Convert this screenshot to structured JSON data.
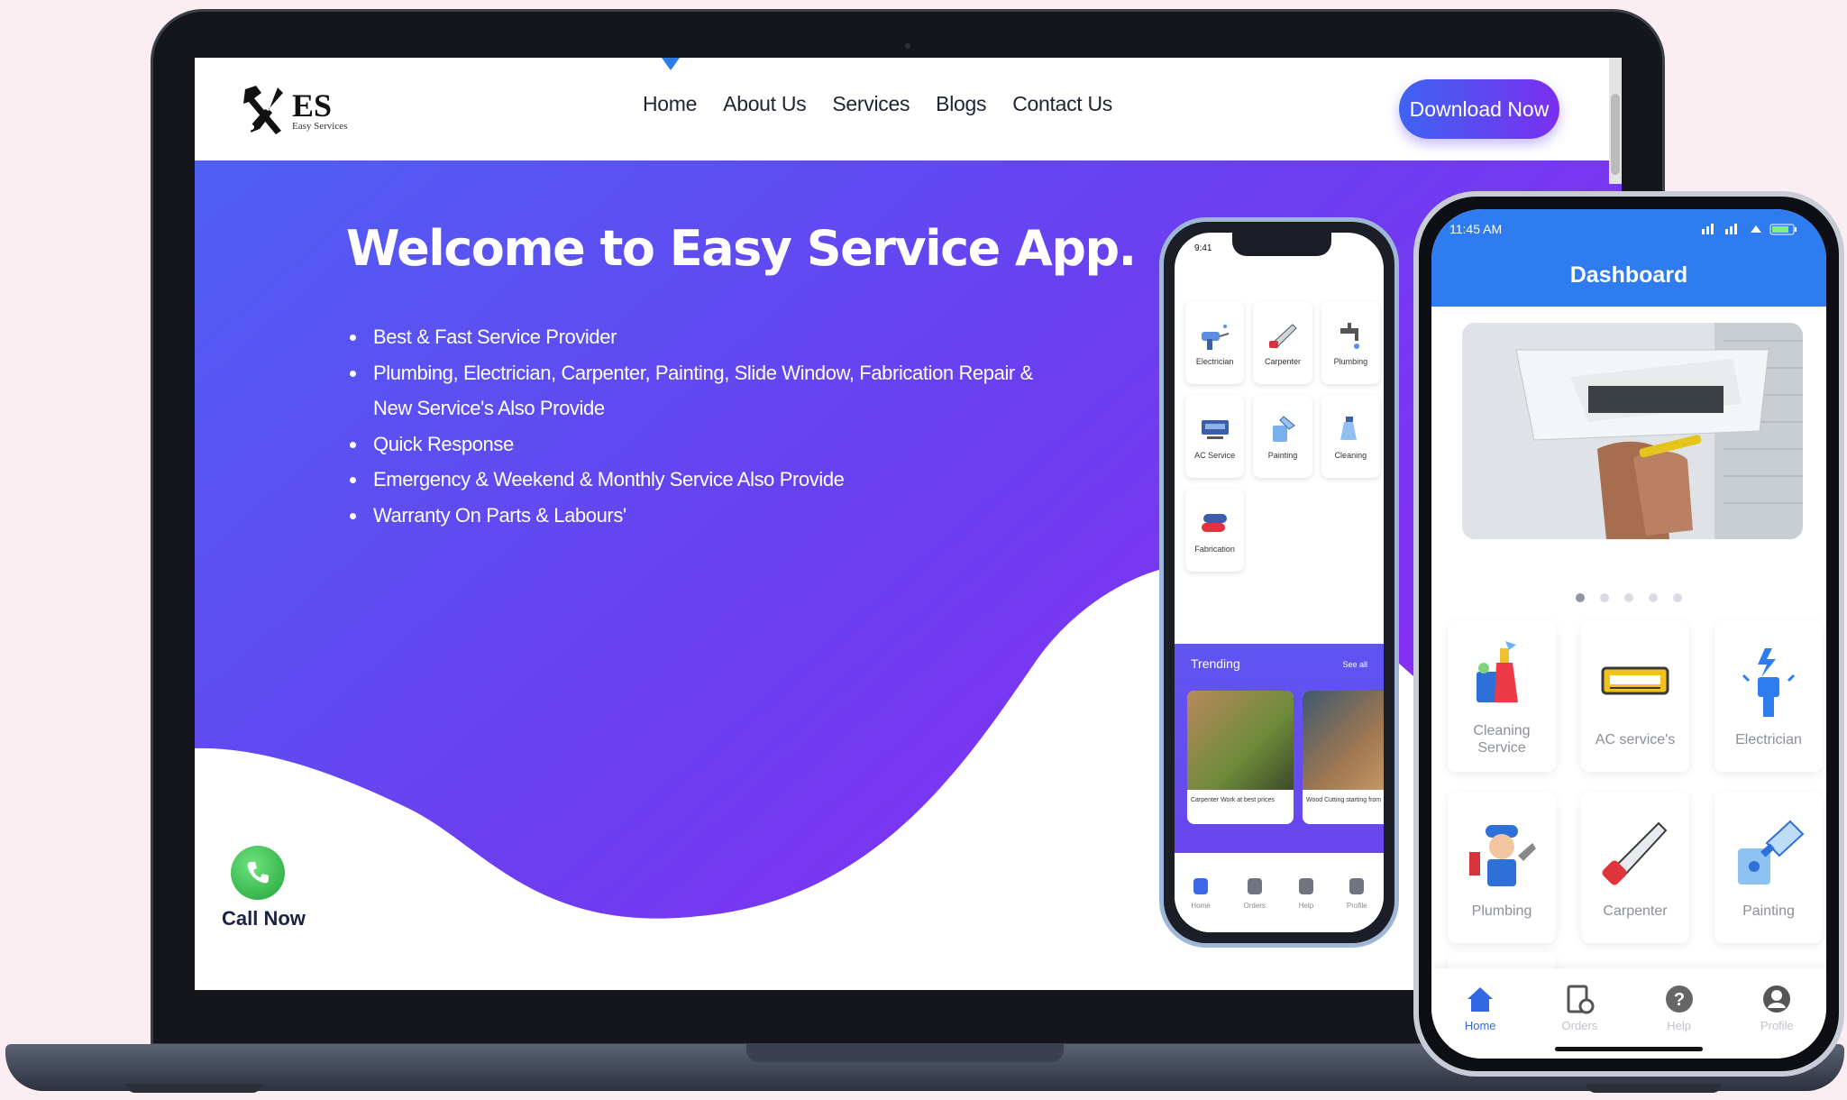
{
  "site": {
    "logo": {
      "letters": "ES",
      "tagline": "Easy Services"
    },
    "nav": [
      "Home",
      "About Us",
      "Services",
      "Blogs",
      "Contact Us"
    ],
    "download_label": "Download Now"
  },
  "hero": {
    "title": "Welcome to Easy Service App.",
    "bullets": [
      "Best & Fast Service Provider",
      "Plumbing, Electrician, Carpenter, Painting, Slide Window, Fabrication Repair & New Service's Also Provide",
      "Quick Response",
      "Emergency & Weekend & Monthly Service Also Provide",
      "Warranty On Parts & Labours'"
    ],
    "call_label": "Call Now"
  },
  "phone_small": {
    "time": "9:41",
    "services": [
      "Electrician",
      "Carpenter",
      "Plumbing",
      "AC Service",
      "Painting",
      "Cleaning",
      "Fabrication"
    ],
    "trending_title": "Trending",
    "see_all": "See all",
    "cards": [
      "Carpenter Work at best prices",
      "Wood Cutting starting from"
    ],
    "bottom_nav": [
      "Home",
      "Orders",
      "Help",
      "Profile"
    ]
  },
  "phone_large": {
    "time": "11:45 AM",
    "title": "Dashboard",
    "services": [
      "Cleaning Service",
      "AC service's",
      "Electrician",
      "Plumbing",
      "Carpenter",
      "Painting"
    ],
    "bottom_nav": [
      "Home",
      "Orders",
      "Help",
      "Profile"
    ]
  },
  "colors": {
    "background": "#fbeef3",
    "hero_gradient_start": "#4f55f3",
    "hero_gradient_end": "#7a2ff0",
    "app_blue": "#2f7bf0",
    "call_green": "#22a33a"
  }
}
